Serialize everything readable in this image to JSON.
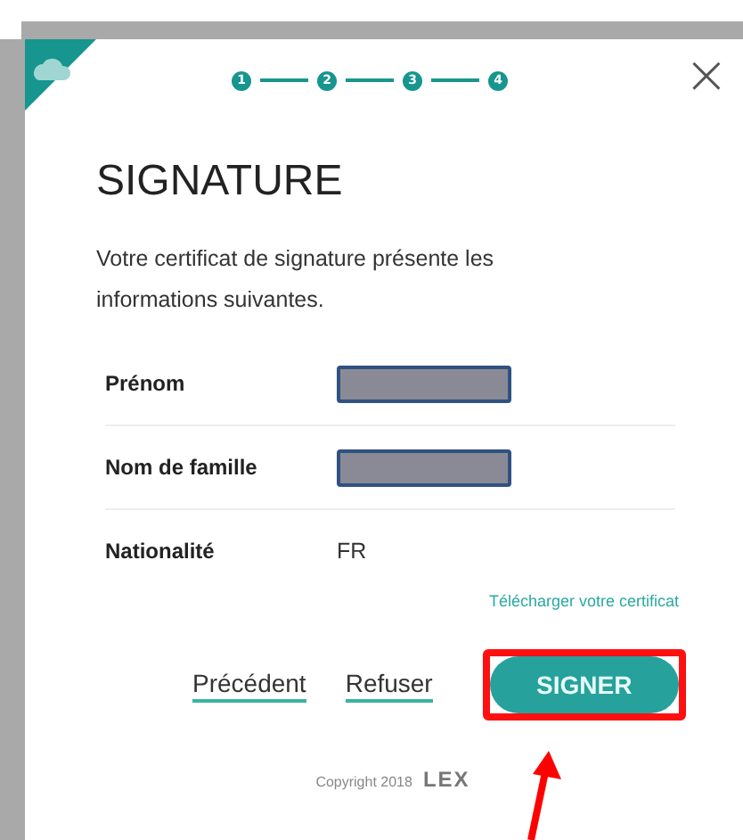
{
  "steps": [
    {
      "number": "1"
    },
    {
      "number": "2"
    },
    {
      "number": "3"
    },
    {
      "number": "4"
    }
  ],
  "close": "×",
  "title": "SIGNATURE",
  "intro": "Votre certificat de signature présente les informations suivantes.",
  "fields": [
    {
      "label": "Prénom",
      "kind": "redacted"
    },
    {
      "label": "Nom de famille",
      "kind": "redacted"
    },
    {
      "label": "Nationalité",
      "kind": "text",
      "value": "FR"
    }
  ],
  "download_link": "Télécharger votre certificat",
  "buttons": {
    "previous": "Précédent",
    "refuse": "Refuser",
    "sign": "SIGNER"
  },
  "footer": {
    "copyright": "Copyright 2018",
    "logo": "LEX"
  }
}
